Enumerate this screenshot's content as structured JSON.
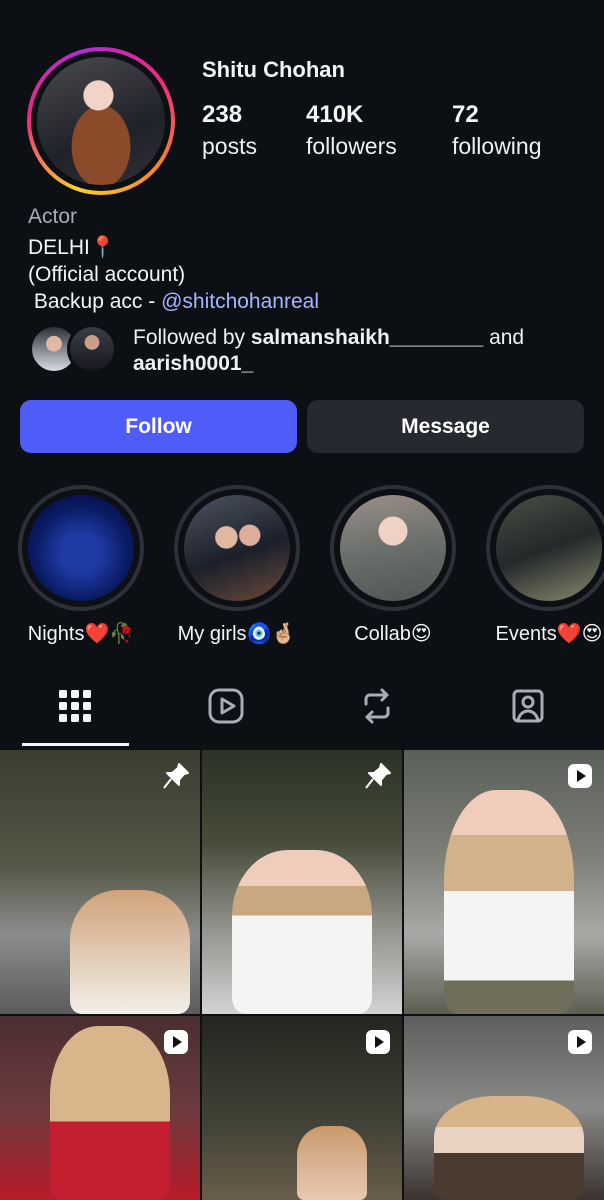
{
  "profile": {
    "username": "Shitu Chohan",
    "stats": [
      {
        "value": "238",
        "label": "posts"
      },
      {
        "value": "410K",
        "label": "followers"
      },
      {
        "value": "72",
        "label": "following"
      }
    ],
    "category": "Actor",
    "bio_line1": "DELHI📍",
    "bio_line2": "(Official account)",
    "bio_line3_prefix": " Backup acc - ",
    "bio_link": "shitchohanreal",
    "followed_by_prefix": "Followed by ",
    "followed_by_user1": "salmanshaikh________",
    "followed_by_and": " and",
    "followed_by_user2": "aarish0001_"
  },
  "actions": {
    "follow_label": "Follow",
    "message_label": "Message"
  },
  "highlights": [
    {
      "label": "Nights❤️🥀"
    },
    {
      "label": "My girls🧿🤞🏼"
    },
    {
      "label": "Collab😍"
    },
    {
      "label": "Events❤️😍"
    }
  ],
  "tabs": [
    {
      "icon": "grid-icon",
      "selected": true
    },
    {
      "icon": "reels-icon",
      "selected": false
    },
    {
      "icon": "reposts-icon",
      "selected": false
    },
    {
      "icon": "tagged-icon",
      "selected": false
    }
  ],
  "posts": [
    {
      "badge": "pin-icon"
    },
    {
      "badge": "pin-icon"
    },
    {
      "badge": "reel-icon"
    },
    {
      "badge": "reel-icon"
    },
    {
      "badge": "reel-icon"
    },
    {
      "badge": "reel-icon"
    }
  ],
  "colors": {
    "background": "#0c0f14",
    "follow_button": "#4e5df7",
    "message_button": "#26292f",
    "link": "#a6b6ff"
  }
}
